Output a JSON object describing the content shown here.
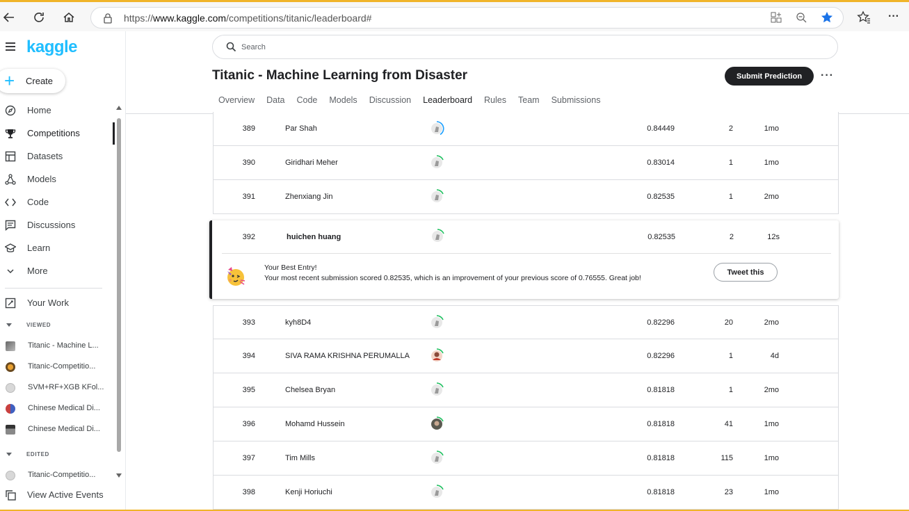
{
  "browser": {
    "url_prefix": "https://",
    "url_domain": "www.kaggle.com",
    "url_path": "/competitions/titanic/leaderboard#"
  },
  "sidebar": {
    "logo": "kaggle",
    "create_label": "Create",
    "nav": [
      {
        "label": "Home",
        "icon": "compass-icon"
      },
      {
        "label": "Competitions",
        "icon": "trophy-icon"
      },
      {
        "label": "Datasets",
        "icon": "table-icon"
      },
      {
        "label": "Models",
        "icon": "models-icon"
      },
      {
        "label": "Code",
        "icon": "code-icon"
      },
      {
        "label": "Discussions",
        "icon": "comment-icon"
      },
      {
        "label": "Learn",
        "icon": "school-icon"
      },
      {
        "label": "More",
        "icon": "chevron-down-icon"
      }
    ],
    "your_work": "Your Work",
    "viewed_heading": "VIEWED",
    "viewed": [
      "Titanic - Machine L...",
      "Titanic-Competitio...",
      "SVM+RF+XGB KFol...",
      "Chinese Medical Di...",
      "Chinese Medical Di..."
    ],
    "edited_heading": "EDITED",
    "edited": [
      "Titanic-Competitio..."
    ],
    "view_events": "View Active Events"
  },
  "header": {
    "search_placeholder": "Search",
    "title": "Titanic - Machine Learning from Disaster",
    "submit_label": "Submit Prediction",
    "more": "···",
    "tabs": [
      "Overview",
      "Data",
      "Code",
      "Models",
      "Discussion",
      "Leaderboard",
      "Rules",
      "Team",
      "Submissions"
    ],
    "active_tab": "Leaderboard"
  },
  "leaderboard": {
    "rows_before": [
      {
        "rank": "389",
        "name": "Par Shah",
        "score": "0.84449",
        "entries": "2",
        "last": "1mo"
      },
      {
        "rank": "390",
        "name": "Giridhari Meher",
        "score": "0.83014",
        "entries": "1",
        "last": "1mo"
      },
      {
        "rank": "391",
        "name": "Zhenxiang Jin",
        "score": "0.82535",
        "entries": "1",
        "last": "2mo"
      }
    ],
    "own": {
      "rank": "392",
      "name": "huichen huang",
      "score": "0.82535",
      "entries": "2",
      "last": "12s"
    },
    "best_entry": {
      "title": "Your Best Entry!",
      "message": "Your most recent submission scored 0.82535, which is an improvement of your previous score of 0.76555. Great job!",
      "tweet_label": "Tweet this"
    },
    "rows_after": [
      {
        "rank": "393",
        "name": "kyh8D4",
        "score": "0.82296",
        "entries": "20",
        "last": "2mo"
      },
      {
        "rank": "394",
        "name": "SIVA RAMA KRISHNA PERUMALLA",
        "score": "0.82296",
        "entries": "1",
        "last": "4d"
      },
      {
        "rank": "395",
        "name": "Chelsea Bryan",
        "score": "0.81818",
        "entries": "1",
        "last": "2mo"
      },
      {
        "rank": "396",
        "name": "Mohamd Hussein",
        "score": "0.81818",
        "entries": "41",
        "last": "1mo"
      },
      {
        "rank": "397",
        "name": "Tim Mills",
        "score": "0.81818",
        "entries": "115",
        "last": "1mo"
      },
      {
        "rank": "398",
        "name": "Kenji Horiuchi",
        "score": "0.81818",
        "entries": "23",
        "last": "1mo"
      }
    ]
  },
  "colors": {
    "accent": "#20beff",
    "ring_green": "#20c060",
    "dark": "#202124"
  }
}
